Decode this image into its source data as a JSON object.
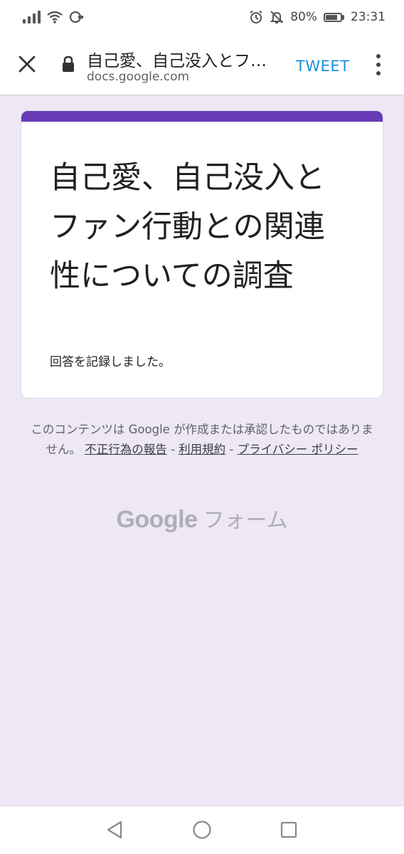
{
  "status_bar": {
    "battery": "80%",
    "battery_level": 0.8,
    "time": "23:31",
    "icons": [
      "signal-icon",
      "wifi-icon",
      "data-saver-icon",
      "alarm-icon",
      "mute-icon",
      "battery-icon"
    ]
  },
  "app_bar": {
    "title": "自己愛、自己没入とフ…",
    "url": "docs.google.com",
    "tweet_label": "TWEET",
    "icons": [
      "close-icon",
      "lock-icon",
      "more-vert-icon"
    ]
  },
  "form": {
    "accent_color": "#673ab7",
    "title": "自己愛、自己没入とファン行動との関連性についての調査",
    "message": "回答を記録しました。"
  },
  "footer": {
    "disclaimer": "このコンテンツは Google が作成または承認したものではありません。",
    "link_report": "不正行為の報告",
    "separator": " - ",
    "link_terms": "利用規約",
    "link_privacy": "プライバシー ポリシー",
    "brand_google": "Google",
    "brand_forms": "フォーム"
  },
  "nav_bar": {
    "icons": [
      "back-icon",
      "home-icon",
      "recents-icon"
    ]
  }
}
